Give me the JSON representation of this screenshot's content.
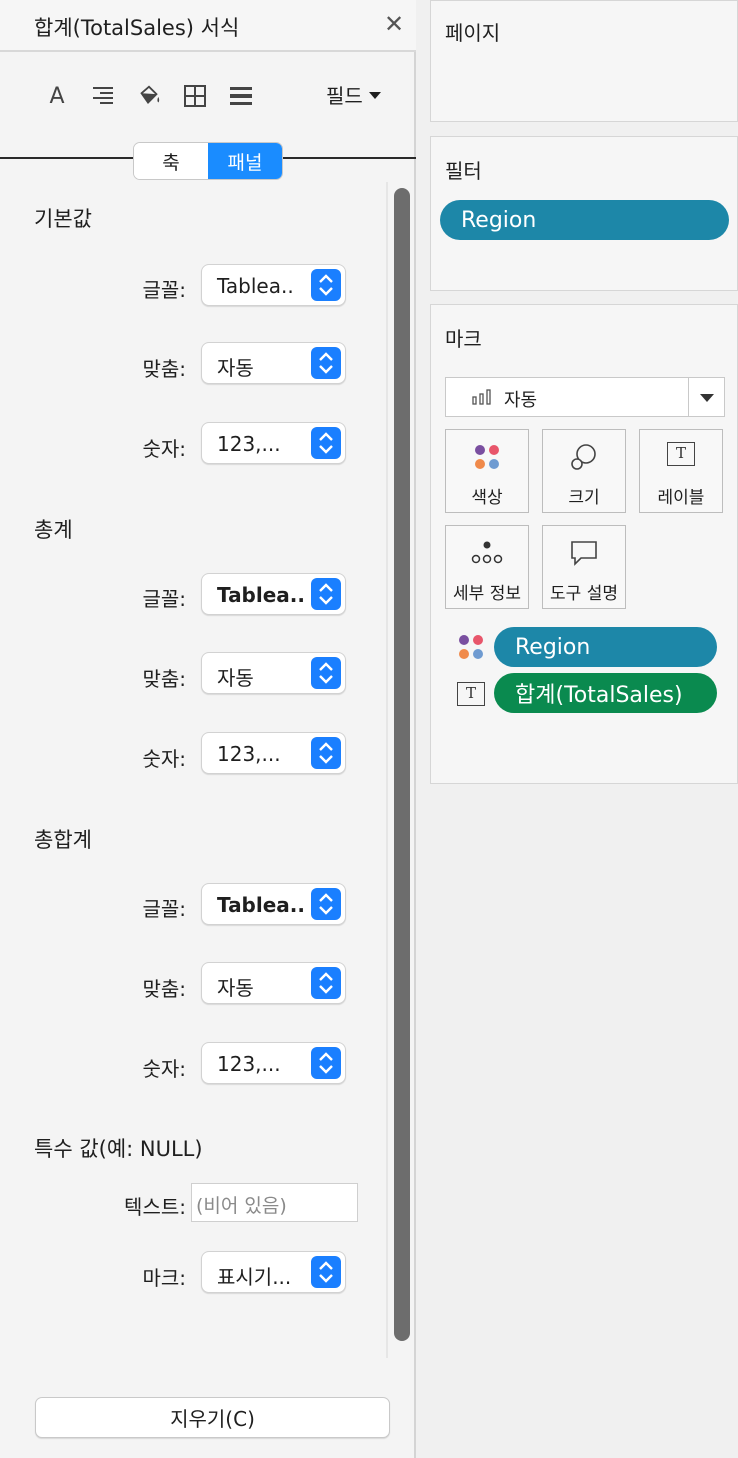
{
  "format_pane": {
    "title": "합계(TotalSales) 서식",
    "close_glyph": "✕",
    "toolbar": {
      "icons": [
        "font-icon",
        "align-icon",
        "shading-icon",
        "borders-icon",
        "lines-icon"
      ],
      "font_glyph": "A",
      "fields_label": "필드"
    },
    "tabs": {
      "axis": "축",
      "pane": "패널",
      "active": "pane"
    },
    "sections": {
      "default": {
        "title": "기본값",
        "font_label": "글꼴:",
        "font_value": "Tablea..",
        "align_label": "맞춤:",
        "align_value": "자동",
        "number_label": "숫자:",
        "number_value": "123,..."
      },
      "totals": {
        "title": "총계",
        "font_label": "글꼴:",
        "font_value": "Tablea..",
        "align_label": "맞춤:",
        "align_value": "자동",
        "number_label": "숫자:",
        "number_value": "123,..."
      },
      "grand_totals": {
        "title": "총합계",
        "font_label": "글꼴:",
        "font_value": "Tablea..",
        "align_label": "맞춤:",
        "align_value": "자동",
        "number_label": "숫자:",
        "number_value": "123,..."
      },
      "special_values": {
        "title": "특수 값(예: NULL)",
        "text_label": "텍스트:",
        "text_placeholder": "(비어 있음)",
        "marks_label": "마크:",
        "marks_value": "표시기..."
      }
    },
    "clear_button": "지우기(C)"
  },
  "sidebar": {
    "pages": {
      "title": "페이지"
    },
    "filters": {
      "title": "필터",
      "pills": [
        "Region"
      ]
    },
    "marks": {
      "title": "마크",
      "mark_type": "자동",
      "buttons": {
        "color": "색상",
        "size": "크기",
        "label": "레이블",
        "detail": "세부 정보",
        "tooltip": "도구 설명"
      },
      "label_glyph": "T",
      "shelf": [
        {
          "encoding": "color",
          "field": "Region"
        },
        {
          "encoding": "text",
          "field": "합계(TotalSales)"
        }
      ]
    },
    "colors": {
      "dimension_pill": "#1d87a8",
      "measure_pill": "#0a8a4f",
      "accent": "#1a8cff"
    }
  }
}
